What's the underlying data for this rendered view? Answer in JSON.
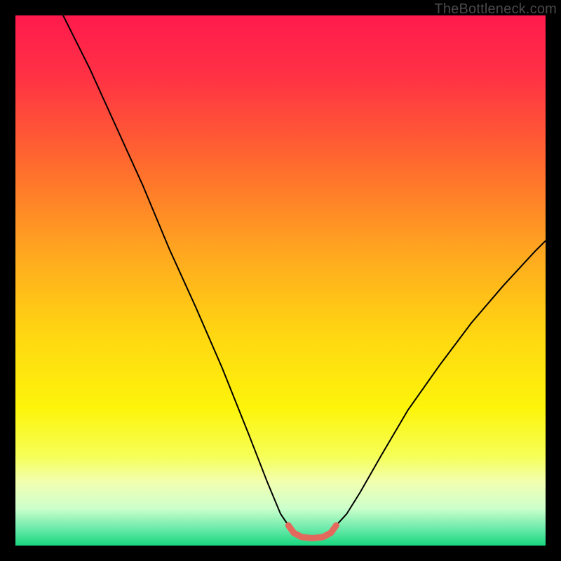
{
  "watermark": "TheBottleneck.com",
  "chart_data": {
    "type": "line",
    "title": "",
    "xlabel": "",
    "ylabel": "",
    "xlim": [
      0,
      100
    ],
    "ylim": [
      0,
      100
    ],
    "grid": false,
    "legend": false,
    "background": {
      "type": "vertical-gradient",
      "stops": [
        {
          "offset": 0.0,
          "color": "#ff1a4d"
        },
        {
          "offset": 0.12,
          "color": "#ff3344"
        },
        {
          "offset": 0.28,
          "color": "#ff6a2e"
        },
        {
          "offset": 0.45,
          "color": "#ffa81f"
        },
        {
          "offset": 0.6,
          "color": "#ffd612"
        },
        {
          "offset": 0.74,
          "color": "#fdf40a"
        },
        {
          "offset": 0.83,
          "color": "#f6ff55"
        },
        {
          "offset": 0.88,
          "color": "#f2ffb0"
        },
        {
          "offset": 0.93,
          "color": "#ccffcc"
        },
        {
          "offset": 0.97,
          "color": "#66e9a8"
        },
        {
          "offset": 1.0,
          "color": "#17d67d"
        }
      ]
    },
    "series": [
      {
        "name": "left-branch",
        "color": "#000000",
        "width": 2,
        "x": [
          9.0,
          14.0,
          19.0,
          24.0,
          29.0,
          34.0,
          39.0,
          44.0,
          47.5,
          50.0,
          51.5
        ],
        "y": [
          100.0,
          90.0,
          79.0,
          68.0,
          56.0,
          45.0,
          33.5,
          21.0,
          12.0,
          6.0,
          3.8
        ]
      },
      {
        "name": "right-branch",
        "color": "#000000",
        "width": 2,
        "x": [
          60.5,
          62.5,
          65.0,
          69.0,
          74.0,
          80.0,
          86.0,
          92.0,
          98.0,
          100.0
        ],
        "y": [
          3.8,
          6.0,
          10.0,
          17.0,
          25.5,
          34.0,
          42.0,
          49.0,
          55.5,
          57.5
        ]
      },
      {
        "name": "bottleneck-band",
        "color": "#e4695d",
        "width": 9,
        "linecap": "round",
        "x": [
          51.5,
          52.5,
          54.0,
          56.0,
          58.0,
          59.5,
          60.5
        ],
        "y": [
          3.8,
          2.4,
          1.6,
          1.4,
          1.6,
          2.4,
          3.8
        ]
      }
    ]
  }
}
